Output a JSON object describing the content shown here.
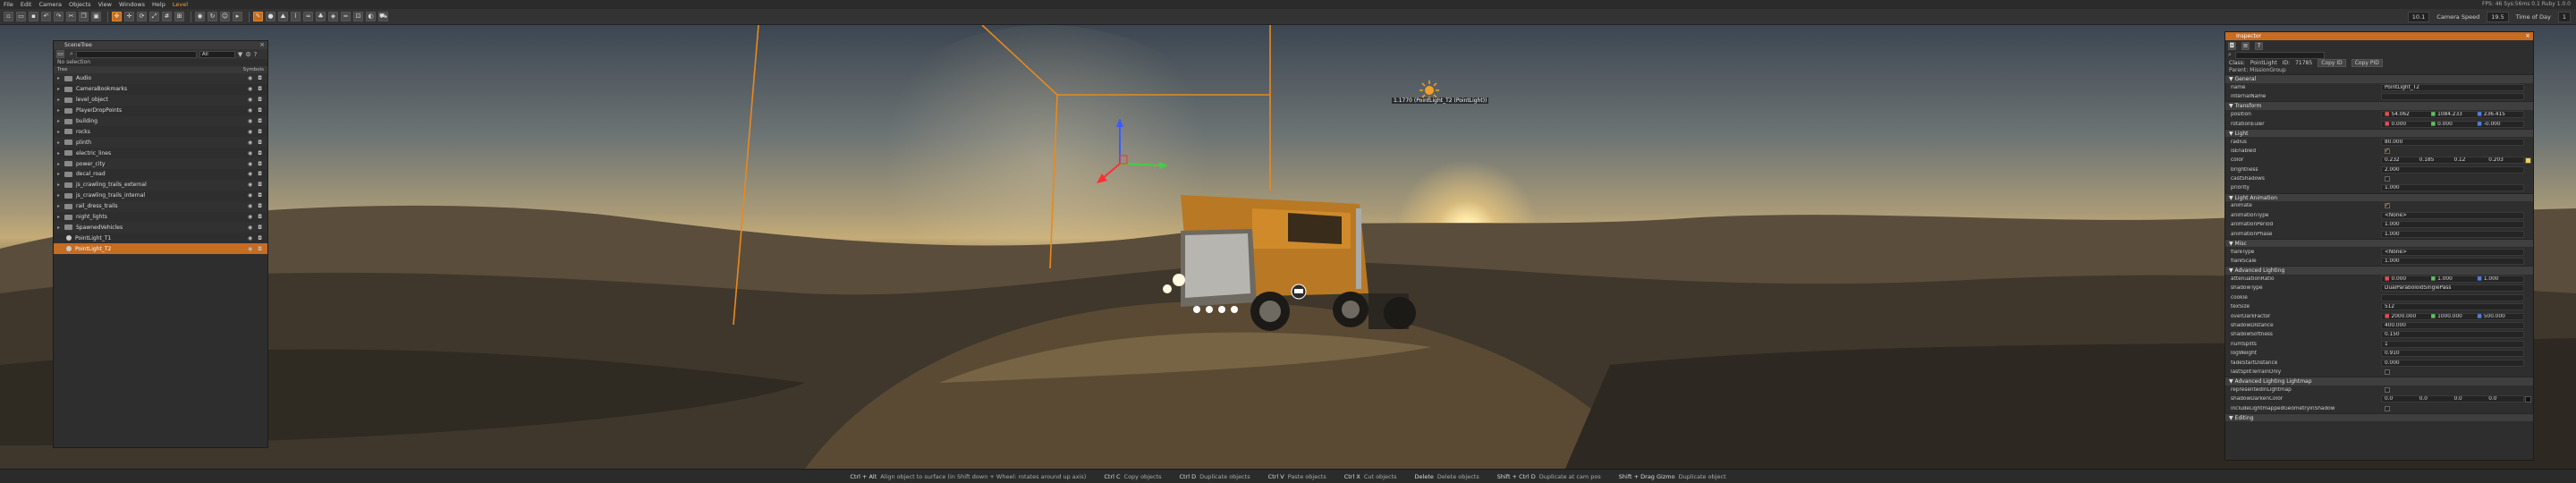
{
  "menu": {
    "items": [
      "File",
      "Edit",
      "Camera",
      "Objects",
      "View",
      "Windows",
      "Help",
      "Level"
    ],
    "active_index": 7,
    "right_info": "FPS: 46  Sys:56ms  0.1  Ruby  1.0.0"
  },
  "toolbar": {
    "camera_speed_label": "Camera Speed",
    "time_of_day_label": "Time of Day",
    "fov_value": "10.1",
    "speed_value": "19.5",
    "tod_value": "1"
  },
  "viewport": {
    "object_label": "1.1770 (PointLight_T2 (PointLight))"
  },
  "scene_tree": {
    "title": "SceneTree",
    "filter_value": "All",
    "selection_label": "No selection",
    "col_tree": "Tree",
    "col_symbols": "Symbols",
    "rows": [
      {
        "label": "Audio",
        "type": "folder"
      },
      {
        "label": "CameraBookmarks",
        "type": "folder"
      },
      {
        "label": "level_object",
        "type": "folder"
      },
      {
        "label": "PlayerDropPoints",
        "type": "folder"
      },
      {
        "label": "building",
        "type": "folder"
      },
      {
        "label": "rocks",
        "type": "folder"
      },
      {
        "label": "plinth",
        "type": "folder"
      },
      {
        "label": "electric_lines",
        "type": "folder"
      },
      {
        "label": "power_city",
        "type": "folder"
      },
      {
        "label": "decal_road",
        "type": "folder"
      },
      {
        "label": "js_crawling_trails_external",
        "type": "folder"
      },
      {
        "label": "js_crawling_trails_internal",
        "type": "folder"
      },
      {
        "label": "rail_dress_trails",
        "type": "folder"
      },
      {
        "label": "night_lights",
        "type": "folder"
      },
      {
        "label": "SpawnedVehicles",
        "type": "folder"
      },
      {
        "label": "PointLight_T1",
        "type": "node"
      },
      {
        "label": "PointLight_T2",
        "type": "node",
        "selected": true
      }
    ]
  },
  "inspector": {
    "title": "Inspector",
    "class_label": "Class:",
    "class_value": "PointLight",
    "id_label": "ID:",
    "id_value": "71785",
    "copy_id_label": "Copy ID",
    "copy_pid_label": "Copy PID",
    "parent_text": "Parent: MissionGroup",
    "sections": [
      {
        "title": "General",
        "props": [
          {
            "name": "name",
            "value": "PointLight_T2"
          },
          {
            "name": "internalName",
            "value": ""
          }
        ]
      },
      {
        "title": "Transform",
        "props": [
          {
            "name": "position",
            "vec": [
              "54.062",
              "1084.233",
              "236.415"
            ]
          },
          {
            "name": "rotationEuler",
            "vec": [
              "0.000",
              "0.000",
              "-0.000"
            ]
          }
        ]
      },
      {
        "title": "Light",
        "props": [
          {
            "name": "radius",
            "value": "80.000"
          },
          {
            "name": "isEnabled",
            "check": true
          },
          {
            "name": "color",
            "vec4": [
              "0.232",
              "0.185",
              "0.12",
              "0.203"
            ],
            "swatch": true
          },
          {
            "name": "brightness",
            "value": "2.000"
          },
          {
            "name": "castShadows",
            "check": false
          },
          {
            "name": "priority",
            "value": "1.000"
          }
        ]
      },
      {
        "title": "Light Animation",
        "props": [
          {
            "name": "animate",
            "check": true
          },
          {
            "name": "animationType",
            "value": "<None>"
          },
          {
            "name": "animationPeriod",
            "value": "1.000"
          },
          {
            "name": "animationPhase",
            "value": "1.000"
          }
        ]
      },
      {
        "title": "Misc",
        "props": [
          {
            "name": "flareType",
            "value": "<None>"
          },
          {
            "name": "flareScale",
            "value": "1.000"
          }
        ]
      },
      {
        "title": "Advanced Lighting",
        "props": [
          {
            "name": "attenuationRatio",
            "vec": [
              "0.000",
              "1.000",
              "1.000"
            ]
          },
          {
            "name": "shadowType",
            "value": "DualParaboloidSinglePass"
          },
          {
            "name": "cookie",
            "value": ""
          },
          {
            "name": "texSize",
            "value": "512"
          },
          {
            "name": "overDarkFactor",
            "vec": [
              "2000.000",
              "1000.000",
              "500.000"
            ]
          },
          {
            "name": "shadowDistance",
            "value": "400.000"
          },
          {
            "name": "shadowSoftness",
            "value": "0.150"
          },
          {
            "name": "numSplits",
            "value": "1"
          },
          {
            "name": "logWeight",
            "value": "0.910"
          },
          {
            "name": "fadeStartDistance",
            "value": "0.000"
          },
          {
            "name": "lastSplitTerrainOnly",
            "check": false
          }
        ]
      },
      {
        "title": "Advanced Lighting Lightmap",
        "props": [
          {
            "name": "representedInLightmap",
            "check": false
          },
          {
            "name": "shadowDarkenColor",
            "vec4": [
              "0.0",
              "0.0",
              "0.0",
              "0.0"
            ],
            "swatch_dark": true
          },
          {
            "name": "includeLightmappedGeometryInShadow",
            "check": false
          }
        ]
      },
      {
        "title": "Editing",
        "props": []
      }
    ]
  },
  "statusbar": {
    "hints": [
      {
        "key": "Ctrl + Alt",
        "action": "Align object to surface (in Shift down + Wheel: rotates around up axis)"
      },
      {
        "key": "Ctrl C",
        "action": "Copy objects"
      },
      {
        "key": "Ctrl D",
        "action": "Duplicate objects"
      },
      {
        "key": "Ctrl V",
        "action": "Paste objects"
      },
      {
        "key": "Ctrl X",
        "action": "Cut objects"
      },
      {
        "key": "Delete",
        "action": "Delete objects"
      },
      {
        "key": "Shift + Ctrl D",
        "action": "Duplicate at cam pos"
      },
      {
        "key": "Shift + Drag Gizmo",
        "action": "Duplicate object"
      }
    ]
  },
  "colors": {
    "accent": "#c66c23",
    "selection_box": "#e8891e"
  }
}
